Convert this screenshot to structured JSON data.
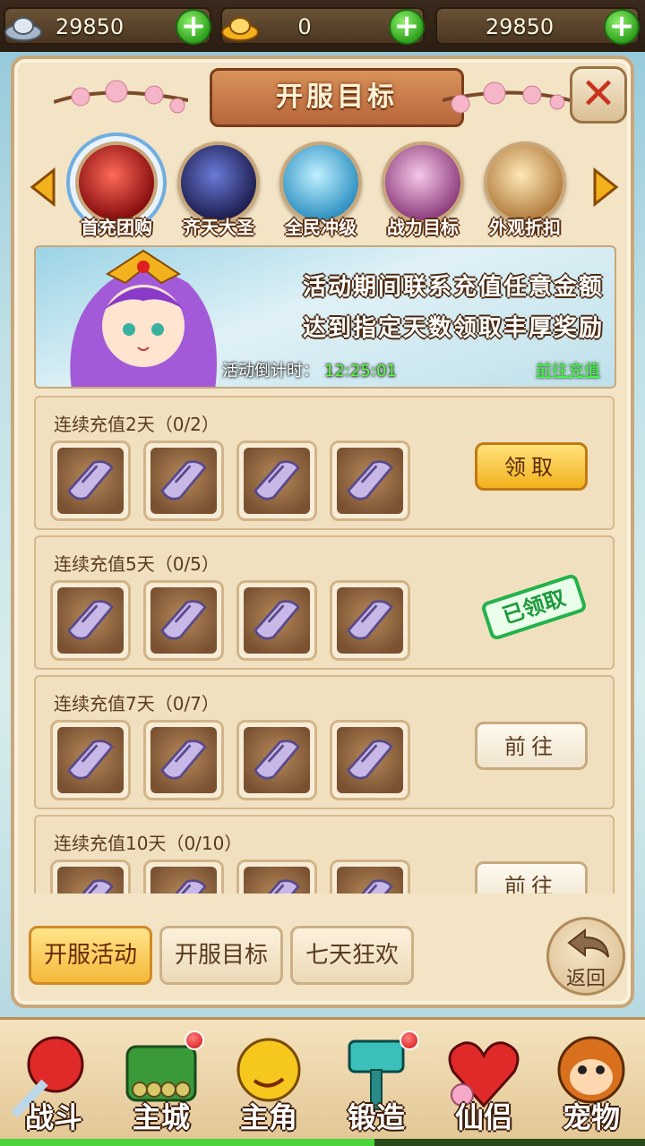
{
  "currencies": [
    {
      "name": "silver-ingot",
      "amount": "29850"
    },
    {
      "name": "gold-ingot",
      "amount": "0"
    },
    {
      "name": "gold-coin",
      "amount": "29850"
    }
  ],
  "panel": {
    "title": "开服目标",
    "close_label": "✕"
  },
  "tabs": [
    {
      "label": "首充团购",
      "color": "#c8201e",
      "selected": true
    },
    {
      "label": "齐天大圣",
      "color": "#3b3a8a",
      "selected": false
    },
    {
      "label": "全民冲级",
      "color": "#4fb6e0",
      "selected": false
    },
    {
      "label": "战力目标",
      "color": "#c05aa8",
      "selected": false
    },
    {
      "label": "外观折扣",
      "color": "#d9a86a",
      "selected": false
    }
  ],
  "banner": {
    "line1": "活动期间联系充值任意金额",
    "line2": "达到指定天数领取丰厚奖励",
    "countdown_label": "活动倒计时：",
    "countdown_value": "12:25:01",
    "link": "前往充值"
  },
  "rewards": [
    {
      "caption": "连续充值2天（0/2）",
      "state": "claim",
      "button": "领取"
    },
    {
      "caption": "连续充值5天（0/5）",
      "state": "claimed",
      "stamp": "已领取"
    },
    {
      "caption": "连续充值7天（0/7）",
      "state": "go",
      "button": "前往"
    },
    {
      "caption": "连续充值10天（0/10）",
      "state": "go",
      "button": "前往"
    }
  ],
  "subtabs": [
    {
      "label": "开服活动",
      "active": true
    },
    {
      "label": "开服目标",
      "active": false
    },
    {
      "label": "七天狂欢",
      "active": false
    }
  ],
  "back_label": "返回",
  "nav": [
    {
      "label": "战斗",
      "icon": "battle-icon",
      "badge": false
    },
    {
      "label": "主城",
      "icon": "main-city-icon",
      "badge": true
    },
    {
      "label": "主角",
      "icon": "hero-icon",
      "badge": false
    },
    {
      "label": "锻造",
      "icon": "forge-hammer-icon",
      "badge": true
    },
    {
      "label": "仙侣",
      "icon": "partner-heart-icon",
      "badge": false
    },
    {
      "label": "宠物",
      "icon": "pet-monkey-icon",
      "badge": false
    }
  ],
  "progress": 0.58
}
